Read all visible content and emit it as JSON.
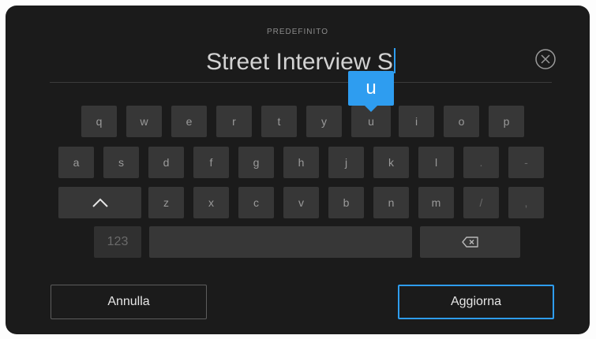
{
  "header": {
    "preset_label": "PREDEFINITO"
  },
  "input": {
    "value": "Street Interview S"
  },
  "keyboard": {
    "preview_key": "u",
    "row1": [
      "q",
      "w",
      "e",
      "r",
      "t",
      "y",
      "u",
      "i",
      "o",
      "p"
    ],
    "row2": [
      "a",
      "s",
      "d",
      "f",
      "g",
      "h",
      "j",
      "k",
      "l",
      ".",
      "-"
    ],
    "row3": [
      "z",
      "x",
      "c",
      "v",
      "b",
      "n",
      "m",
      "/",
      ","
    ],
    "numbers_label": "123",
    "shift_icon": "chevron-up-icon",
    "backspace_icon": "backspace-icon"
  },
  "buttons": {
    "cancel": "Annulla",
    "update": "Aggiorna"
  },
  "colors": {
    "accent": "#2e9df0",
    "background": "#1b1b1b",
    "key": "#373737"
  }
}
